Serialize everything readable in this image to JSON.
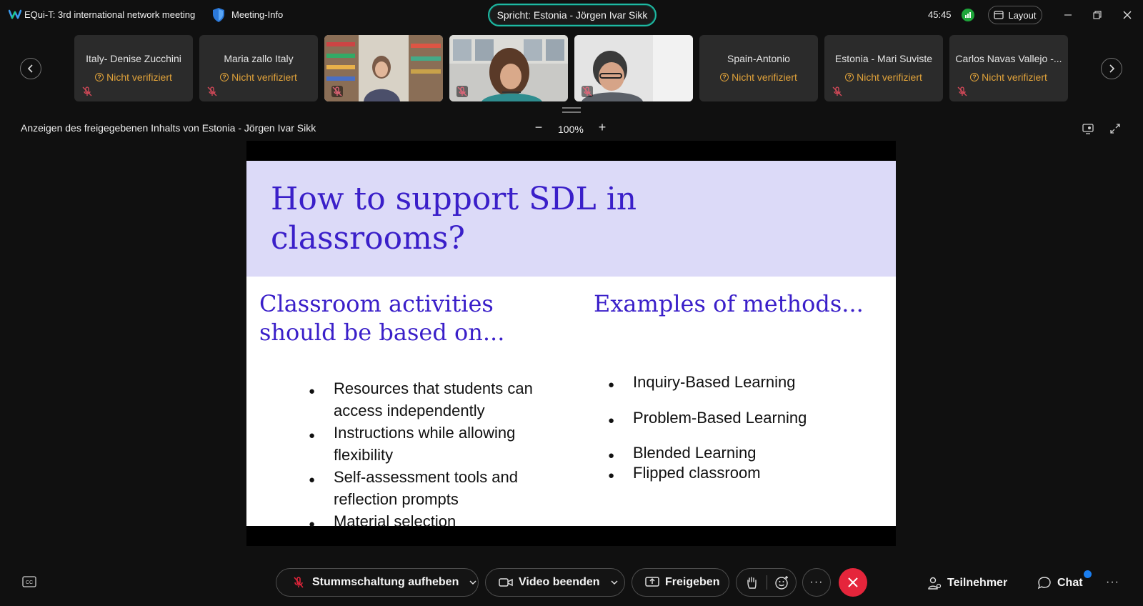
{
  "topbar": {
    "meeting_title": "EQui-T: 3rd international network meeting",
    "meeting_info": "Meeting-Info",
    "speaking": "Spricht: Estonia - Jörgen Ivar Sikk",
    "timer": "45:45",
    "layout_label": "Layout"
  },
  "participants": [
    {
      "name": "Italy- Denise Zucchini",
      "status": "Nicht verifiziert"
    },
    {
      "name": "Maria zallo Italy",
      "status": "Nicht verifiziert"
    },
    {
      "name": "",
      "status": ""
    },
    {
      "name": "",
      "status": ""
    },
    {
      "name": "",
      "status": ""
    },
    {
      "name": "Spain-Antonio",
      "status": "Nicht verifiziert"
    },
    {
      "name": "Estonia - Mari Suviste",
      "status": "Nicht verifiziert"
    },
    {
      "name": "Carlos Navas Vallejo -...",
      "status": "Nicht verifiziert"
    }
  ],
  "share": {
    "label": "Anzeigen des freigegebenen Inhalts von Estonia - Jörgen Ivar Sikk",
    "zoom": "100%"
  },
  "slide": {
    "title_line1": "How to support SDL in",
    "title_line2": "classrooms?",
    "left_title_line1": "Classroom activities",
    "left_title_line2": "should be based on...",
    "left_bullets": [
      "Resources that students can access independently",
      "Instructions while allowing flexibility",
      "Self-assessment tools and reflection prompts",
      "Material selection"
    ],
    "right_title": "Examples of methods...",
    "right_bullets": [
      "Inquiry-Based Learning",
      "Problem-Based Learning",
      "Blended Learning",
      "Flipped classroom"
    ]
  },
  "toolbar": {
    "unmute": "Stummschaltung aufheben",
    "video": "Video beenden",
    "share": "Freigeben",
    "participants": "Teilnehmer",
    "chat": "Chat",
    "more": "···"
  },
  "colors": {
    "accent_teal": "#1fb9a2",
    "warning": "#e0a23a",
    "end_call": "#e5253b",
    "slide_title": "#3a1fc9",
    "slide_header_bg": "#dcdaf8",
    "signal_green": "#1ea53a"
  }
}
